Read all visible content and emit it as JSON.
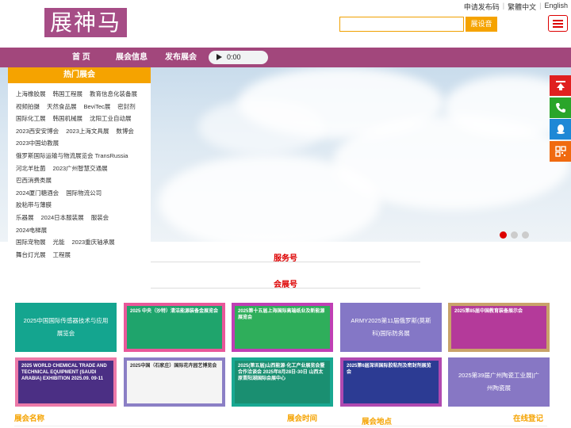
{
  "header": {
    "top_links": [
      "申请发布码",
      "繁體中文",
      "English"
    ],
    "logo_text": "展神马",
    "search": {
      "value": "",
      "button_label": "展设音"
    }
  },
  "nav": {
    "items": [
      "首 页",
      "展会信息",
      "发布展会"
    ],
    "audio_time": "0:00"
  },
  "hot": {
    "title": "热门展会",
    "items": [
      "上海橡胶展",
      "韩国工程展",
      "教育信息化装备展",
      "视频拍摄",
      "天然食品展",
      "BeviTec展",
      "密封剂",
      "国际化工展",
      "韩国机械展",
      "沈阳工业自动展",
      "2023西安安博会",
      "2023上海文具展",
      "数博会",
      "2023中国幼教展",
      "俄罗斯国际运输与物流展览会 TransRussia",
      "河北羊肚菌",
      "2023广州智慧交通展",
      "巴西消费类展",
      "2024厦门糖酒会",
      "国际物流公司",
      "胶粘带与薄膜",
      "乐器展",
      "2024日本服装展",
      "服装会",
      "2024电梯展",
      "国际宠物展",
      "光能",
      "2023重庆轴承展",
      "舞台灯光展",
      "工程展"
    ]
  },
  "sections": {
    "service": "服务号",
    "expo": "会展号"
  },
  "cards": [
    {
      "type": "text",
      "text": "2025中国国际传感器技术与应用展览会",
      "color": "#14a58f"
    },
    {
      "type": "img",
      "text": "2025 中央（沙特）清洁能源装备金展览会",
      "border": "#e9589a",
      "bg": "#1fa46c"
    },
    {
      "type": "img",
      "text": "2025第十五届上海国际高端纸业及新能源展览会",
      "border": "#c03fb5",
      "bg": "#2fae5b"
    },
    {
      "type": "text",
      "text": "ARMY2025第11届俄罗斯(莫斯科)国际防务展",
      "color": "#8477c6"
    },
    {
      "type": "img",
      "text": "2025第85届中国教育装备展示会",
      "border": "#c9a36a",
      "bg": "#b43a9a"
    },
    {
      "type": "img",
      "text": "2025 WORLD CHEMICAL TRADE AND TECHNICAL EQUIPMENT (SAUDI ARABIA) EXHIBITION 2025.09. 09-11",
      "border": "#ec79a8",
      "bg": "#4b2f84"
    },
    {
      "type": "img",
      "text": "2025中国（石家庄）国际花卉园艺博览会",
      "border": "#8b7fc5",
      "bg": "#f4f4f4"
    },
    {
      "type": "img",
      "text": "2025(第五届)山西能源·化工产业展览会暨合作洽谈会 2025年8月28日-30日 山西太原晋阳湖国际会展中心",
      "border": "#19a892",
      "bg": "#1a8f71"
    },
    {
      "type": "img",
      "text": "2025第6届深圳国际胶粘剂及密封剂展览会",
      "border": "#b049b0",
      "bg": "#2c3b93"
    },
    {
      "type": "text",
      "text": "2025第39届广州陶瓷工业展|广州陶瓷展",
      "color": "#8777c4"
    }
  ],
  "bottom_labels": [
    "展会名称",
    "展会时间",
    "展会地点",
    "在线登记"
  ],
  "colors": {
    "brand": "#a2477c",
    "accent": "#f5a300",
    "highlight": "#dd0000"
  }
}
